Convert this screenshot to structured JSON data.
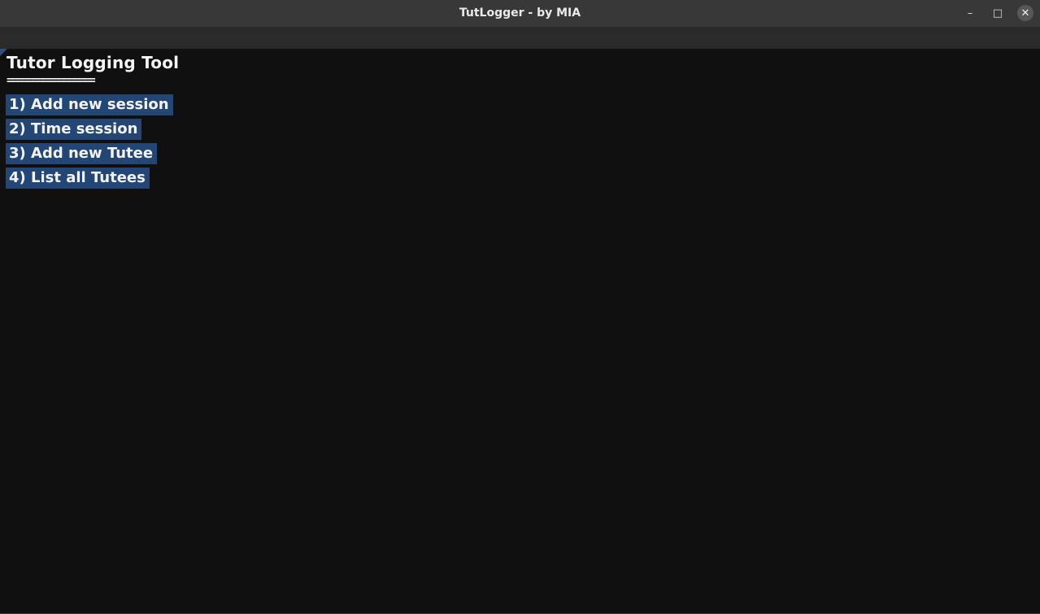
{
  "window": {
    "title": "TutLogger - by MIA",
    "minimize_glyph": "–",
    "maximize_glyph": "□",
    "close_glyph": "✕"
  },
  "app": {
    "heading": "Tutor Logging Tool",
    "divider": "=================",
    "menu": [
      {
        "label": "1) Add new session"
      },
      {
        "label": "2) Time session"
      },
      {
        "label": "3) Add new Tutee"
      },
      {
        "label": "4) List all Tutees"
      }
    ]
  },
  "colors": {
    "background": "#101010",
    "titlebar": "#383838",
    "menu_highlight": "#234675",
    "text": "#f4f4f4"
  }
}
